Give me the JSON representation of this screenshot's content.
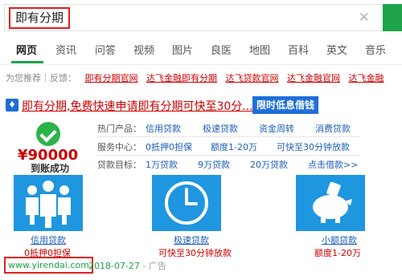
{
  "search": {
    "query": "即有分期",
    "clear_icon": "close-icon"
  },
  "tabs": [
    "网页",
    "资讯",
    "问答",
    "视频",
    "图片",
    "良医",
    "地图",
    "百科",
    "英文",
    "音乐"
  ],
  "recommend": {
    "label": "为您推荐｜反馈：",
    "links": [
      "即有分期官网",
      "达飞金融即有分期",
      "达飞贷款官网",
      "达飞金融官网",
      "达飞金融"
    ]
  },
  "ad": {
    "title": "即有分期,免费快速申请即有分期可快至30分...",
    "promo_button": "限时低息借钱",
    "amount": "¥90000",
    "amount_sub": "到账成功",
    "rows": [
      {
        "label": "热门产品：",
        "links": [
          "信用贷款",
          "极速贷款",
          "资金周转",
          "消费贷款"
        ]
      },
      {
        "label": "服务中心：",
        "links": [
          "0抵押0担保",
          "额度1-20万",
          "可快至30分钟放款"
        ]
      },
      {
        "label": "贷款目标：",
        "links": [
          "1万贷款",
          "9万贷款",
          "20万贷款",
          "点击借款>>"
        ]
      }
    ],
    "products": [
      {
        "name": "信用贷款",
        "sub": "0抵押0担保",
        "icon": "people-icon"
      },
      {
        "name": "极速贷款",
        "sub": "可快至30分钟放款",
        "icon": "clock-icon"
      },
      {
        "name": "小额贷款",
        "sub": "额度1-20万",
        "icon": "piggy-bank-icon"
      }
    ],
    "site": "www.yirendai.com",
    "date": "2018-07-27",
    "ad_tag": " - 广告"
  },
  "colors": {
    "accent_green": "#1ea34a",
    "link_red": "#cc0000",
    "link_blue": "#1e5fb8",
    "tile_blue": "#1f96e0",
    "highlight_red": "#e02020"
  }
}
